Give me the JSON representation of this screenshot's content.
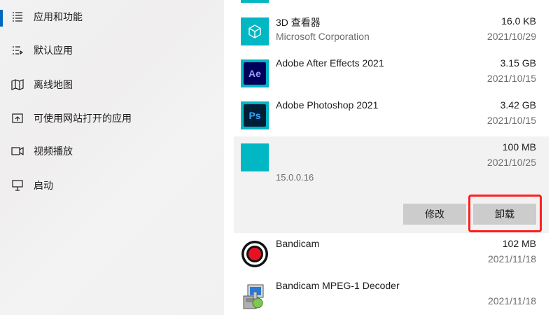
{
  "sidebar": {
    "items": [
      {
        "label": "应用和功能",
        "icon": "apps-list-icon",
        "active": true
      },
      {
        "label": "默认应用",
        "icon": "default-apps-icon",
        "active": false
      },
      {
        "label": "离线地图",
        "icon": "map-icon",
        "active": false
      },
      {
        "label": "可使用网站打开的应用",
        "icon": "web-apps-icon",
        "active": false
      },
      {
        "label": "视频播放",
        "icon": "video-icon",
        "active": false
      },
      {
        "label": "启动",
        "icon": "startup-icon",
        "active": false
      }
    ]
  },
  "apps": [
    {
      "name": "3D 查看器",
      "publisher": "Microsoft Corporation",
      "size": "16.0 KB",
      "date": "2021/10/29",
      "icon": "3d-viewer-icon"
    },
    {
      "name": "Adobe After Effects 2021",
      "publisher": "",
      "size": "3.15 GB",
      "date": "2021/10/15",
      "icon": "after-effects-icon",
      "icon_text": "Ae"
    },
    {
      "name": "Adobe Photoshop 2021",
      "publisher": "",
      "size": "3.42 GB",
      "date": "2021/10/15",
      "icon": "photoshop-icon",
      "icon_text": "Ps"
    },
    {
      "name": "",
      "publisher": "",
      "size": "100 MB",
      "date": "2021/10/25",
      "version": "15.0.0.16",
      "icon": "generic-app-icon",
      "expanded": true,
      "buttons": {
        "modify": "修改",
        "uninstall": "卸载"
      }
    },
    {
      "name": "Bandicam",
      "publisher": "",
      "size": "102 MB",
      "date": "2021/11/18",
      "icon": "bandicam-icon"
    },
    {
      "name": "Bandicam MPEG-1 Decoder",
      "publisher": "",
      "size": "",
      "date": "2021/11/18",
      "icon": "installer-icon"
    }
  ],
  "colors": {
    "accent": "#0067c0",
    "tile": "#00b7c3",
    "highlight": "#ff1e1e",
    "button": "#cccccc"
  }
}
